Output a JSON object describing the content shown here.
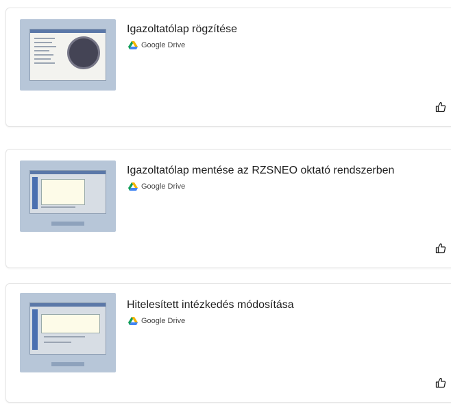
{
  "items": [
    {
      "title": "Igazoltatólap rögzítése",
      "source": "Google Drive"
    },
    {
      "title": "Igazoltatólap mentése az RZSNEO oktató rendszerben",
      "source": "Google Drive"
    },
    {
      "title": "Hitelesített intézkedés módosítása",
      "source": "Google Drive"
    }
  ],
  "icons": {
    "source_icon": "google-drive-icon",
    "action_icon": "thumbs-up-icon"
  },
  "colors": {
    "thumb_bg": "#b7c6d8",
    "drive_green": "#0f9d58",
    "drive_blue": "#4285f4",
    "drive_yellow": "#f4b400"
  }
}
